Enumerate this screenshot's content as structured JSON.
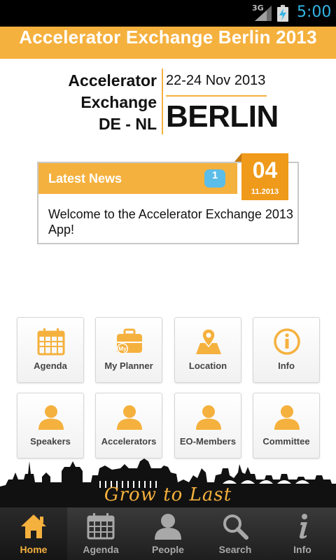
{
  "status_bar": {
    "network": "3G",
    "time": "5:00"
  },
  "title": "Accelerator Exchange Berlin 2013",
  "logo": {
    "line1": "Accelerator",
    "line2": "Exchange",
    "line3": "DE - NL",
    "dates": "22-24 Nov 2013",
    "city": "BERLIN"
  },
  "news": {
    "title": "Latest News",
    "count": "1",
    "message": "Welcome to the Accelerator Exchange 2013 App!",
    "day": "04",
    "month": "11.2013"
  },
  "tiles": [
    {
      "label": "Agenda",
      "icon": "calendar-icon"
    },
    {
      "label": "My Planner",
      "icon": "briefcase-icon"
    },
    {
      "label": "Location",
      "icon": "map-pin-icon"
    },
    {
      "label": "Info",
      "icon": "info-icon"
    },
    {
      "label": "Speakers",
      "icon": "person-icon"
    },
    {
      "label": "Accelerators",
      "icon": "person-icon"
    },
    {
      "label": "EO-Members",
      "icon": "person-icon"
    },
    {
      "label": "Committee",
      "icon": "person-icon"
    }
  ],
  "slogan": "Grow to Last",
  "bottom_nav": [
    {
      "label": "Home",
      "icon": "home-icon",
      "active": true
    },
    {
      "label": "Agenda",
      "icon": "calendar-icon",
      "active": false
    },
    {
      "label": "People",
      "icon": "person-icon",
      "active": false
    },
    {
      "label": "Search",
      "icon": "search-icon",
      "active": false
    },
    {
      "label": "Info",
      "icon": "info-icon",
      "active": false
    }
  ],
  "colors": {
    "accent": "#f5b13e",
    "date_box": "#ef9a1a",
    "badge": "#5bbde8",
    "clock": "#33b5e5",
    "nav_background": "#2a2a2a"
  }
}
